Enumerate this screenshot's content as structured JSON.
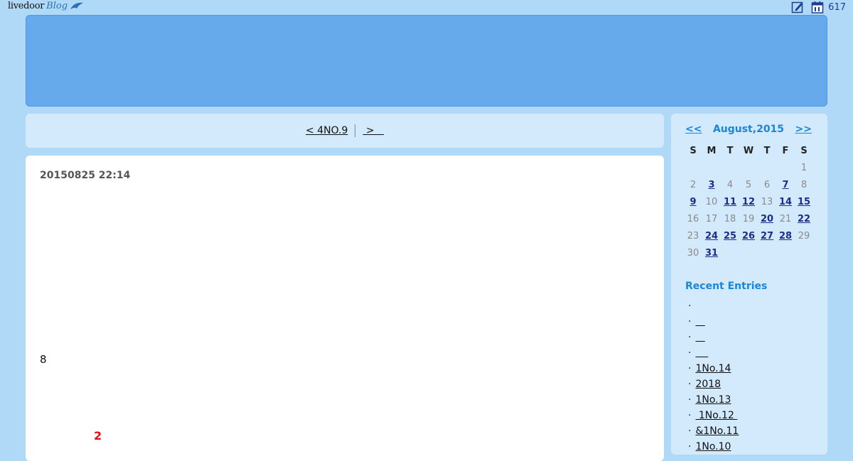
{
  "topbar": {
    "logo_word": "livedoor",
    "logo_blog": "Blog",
    "counter": "617"
  },
  "pager": {
    "prev": "< 4NO.9",
    "next": " >   "
  },
  "post": {
    "date": "20150825 22:14",
    "text": "8",
    "red_text": "2"
  },
  "calendar": {
    "prev": "<<",
    "title": "August,2015",
    "next": ">>",
    "weekdays": [
      "S",
      "M",
      "T",
      "W",
      "T",
      "F",
      "S"
    ],
    "weeks": [
      [
        null,
        null,
        null,
        null,
        null,
        null,
        {
          "d": "1",
          "link": false
        }
      ],
      [
        {
          "d": "2",
          "link": false
        },
        {
          "d": "3",
          "link": true
        },
        {
          "d": "4",
          "link": false
        },
        {
          "d": "5",
          "link": false
        },
        {
          "d": "6",
          "link": false
        },
        {
          "d": "7",
          "link": true
        },
        {
          "d": "8",
          "link": false
        }
      ],
      [
        {
          "d": "9",
          "link": true
        },
        {
          "d": "10",
          "link": false
        },
        {
          "d": "11",
          "link": true
        },
        {
          "d": "12",
          "link": true
        },
        {
          "d": "13",
          "link": false
        },
        {
          "d": "14",
          "link": true
        },
        {
          "d": "15",
          "link": true
        }
      ],
      [
        {
          "d": "16",
          "link": false
        },
        {
          "d": "17",
          "link": false
        },
        {
          "d": "18",
          "link": false
        },
        {
          "d": "19",
          "link": false
        },
        {
          "d": "20",
          "link": true
        },
        {
          "d": "21",
          "link": false
        },
        {
          "d": "22",
          "link": true
        }
      ],
      [
        {
          "d": "23",
          "link": false
        },
        {
          "d": "24",
          "link": true
        },
        {
          "d": "25",
          "link": true
        },
        {
          "d": "26",
          "link": true
        },
        {
          "d": "27",
          "link": true
        },
        {
          "d": "28",
          "link": true
        },
        {
          "d": "29",
          "link": false
        }
      ],
      [
        {
          "d": "30",
          "link": false
        },
        {
          "d": "31",
          "link": true
        },
        null,
        null,
        null,
        null,
        null
      ]
    ]
  },
  "recent": {
    "title": "Recent Entries",
    "dot": "·",
    "items": [
      "",
      "   ",
      "   ",
      "    ",
      "1No.14",
      "2018",
      "1No.13",
      " 1No.12 ",
      "&1No.11",
      "1No.10"
    ]
  },
  "icons": {
    "edit": "edit-icon",
    "calendar": "calendar-icon"
  },
  "colors": {
    "background": "#b0d8f7",
    "header": "#66aaeb",
    "panel": "#d3e9fc",
    "accent": "#1a86d8",
    "link_day": "#1b2c8a",
    "red": "#dd1111"
  }
}
